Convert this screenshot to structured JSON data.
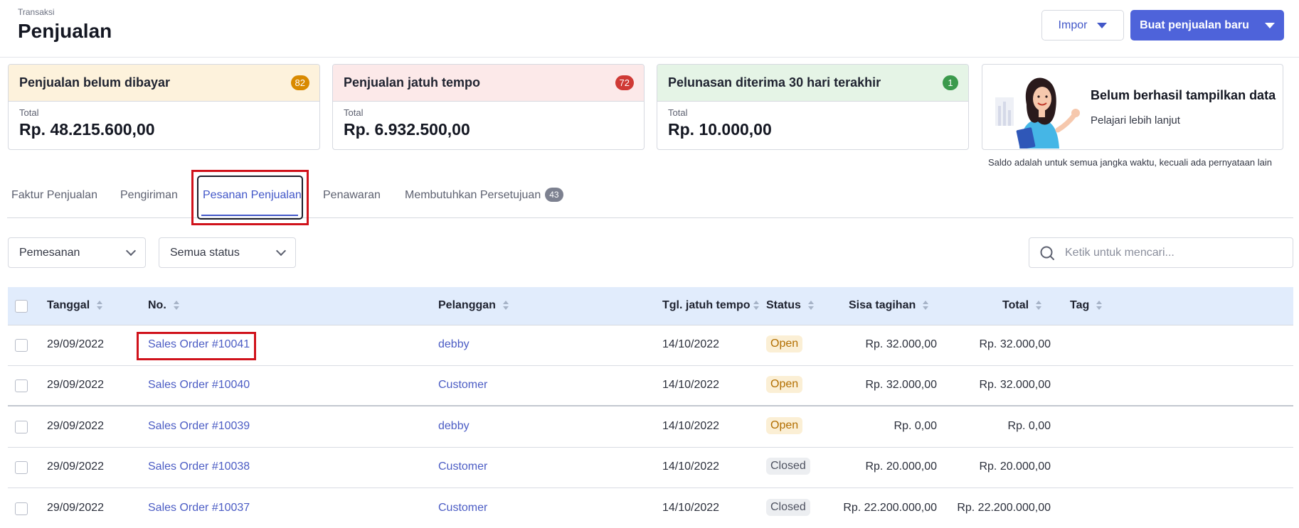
{
  "header": {
    "breadcrumb": "Transaksi",
    "title": "Penjualan",
    "import_label": "Impor",
    "new_sale_label": "Buat penjualan baru"
  },
  "cards": [
    {
      "title": "Penjualan belum dibayar",
      "badge": "82",
      "badge_color": "#d98a00",
      "head_bg": "#fdf2dc",
      "label": "Total",
      "value": "Rp. 48.215.600,00"
    },
    {
      "title": "Penjualan jatuh tempo",
      "badge": "72",
      "badge_color": "#cf3a35",
      "head_bg": "#fce9e9",
      "label": "Total",
      "value": "Rp. 6.932.500,00"
    },
    {
      "title": "Pelunasan diterima 30 hari terakhir",
      "badge": "1",
      "badge_color": "#3b9a4c",
      "head_bg": "#e5f4e6",
      "label": "Total",
      "value": "Rp. 10.000,00"
    }
  ],
  "promo": {
    "title": "Belum berhasil tampilkan data",
    "link": "Pelajari lebih lanjut"
  },
  "saldo_note": "Saldo adalah untuk semua jangka waktu, kecuali ada pernyataan lain",
  "tabs": [
    {
      "label": "Faktur Penjualan"
    },
    {
      "label": "Pengiriman"
    },
    {
      "label": "Pesanan Penjualan"
    },
    {
      "label": "Penawaran"
    },
    {
      "label": "Membutuhkan Persetujuan",
      "count": "43"
    }
  ],
  "filters": {
    "order_type": "Pemesanan",
    "status": "Semua status",
    "search_placeholder": "Ketik untuk mencari..."
  },
  "table": {
    "columns": [
      "Tanggal",
      "No.",
      "Pelanggan",
      "Tgl. jatuh tempo",
      "Status",
      "Sisa tagihan",
      "Total",
      "Tag"
    ],
    "rows": [
      {
        "date": "29/09/2022",
        "no": "Sales Order #10041",
        "customer": "debby",
        "due": "14/10/2022",
        "status": "Open",
        "balance": "Rp. 32.000,00",
        "total": "Rp. 32.000,00",
        "tag": ""
      },
      {
        "date": "29/09/2022",
        "no": "Sales Order #10040",
        "customer": "Customer",
        "due": "14/10/2022",
        "status": "Open",
        "balance": "Rp. 32.000,00",
        "total": "Rp. 32.000,00",
        "tag": ""
      },
      {
        "date": "29/09/2022",
        "no": "Sales Order #10039",
        "customer": "debby",
        "due": "14/10/2022",
        "status": "Open",
        "balance": "Rp. 0,00",
        "total": "Rp. 0,00",
        "tag": ""
      },
      {
        "date": "29/09/2022",
        "no": "Sales Order #10038",
        "customer": "Customer",
        "due": "14/10/2022",
        "status": "Closed",
        "balance": "Rp. 20.000,00",
        "total": "Rp. 20.000,00",
        "tag": ""
      },
      {
        "date": "29/09/2022",
        "no": "Sales Order #10037",
        "customer": "Customer",
        "due": "14/10/2022",
        "status": "Closed",
        "balance": "Rp. 22.200.000,00",
        "total": "Rp. 22.200.000,00",
        "tag": ""
      }
    ]
  }
}
